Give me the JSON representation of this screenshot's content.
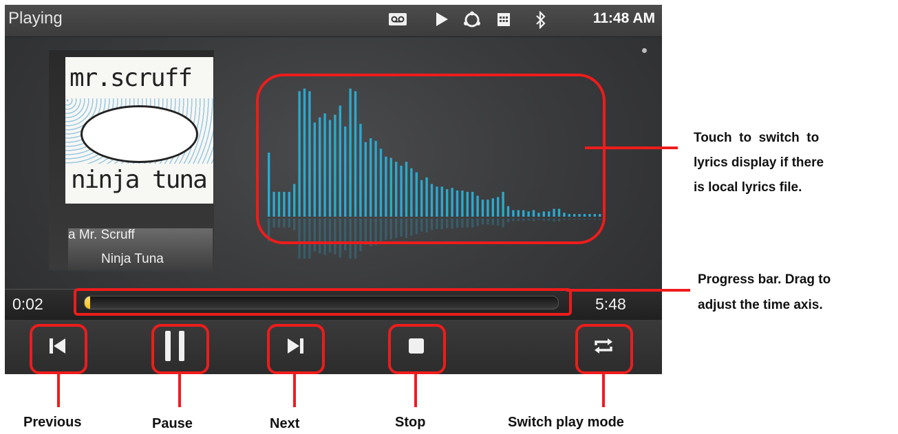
{
  "status_bar": {
    "title": "Playing",
    "time": "11:48 AM",
    "icons": [
      "voicemail-icon",
      "play-status-icon",
      "sync-icon",
      "calendar-icon",
      "bluetooth-icon"
    ]
  },
  "now_playing": {
    "artist": "a Mr. Scruff",
    "album": "Ninja Tuna",
    "cover_text_top": "mr.scruff",
    "cover_text_bottom": "ninja tuna"
  },
  "visualizer": {
    "bar_levels": [
      0.49,
      0.19,
      0.19,
      0.19,
      0.19,
      0.25,
      0.96,
      0.98,
      0.96,
      0.72,
      0.76,
      0.79,
      0.74,
      0.78,
      0.85,
      0.69,
      0.98,
      0.96,
      0.71,
      0.57,
      0.6,
      0.58,
      0.52,
      0.46,
      0.45,
      0.42,
      0.39,
      0.42,
      0.37,
      0.34,
      0.28,
      0.3,
      0.25,
      0.23,
      0.23,
      0.21,
      0.22,
      0.2,
      0.2,
      0.19,
      0.19,
      0.16,
      0.13,
      0.13,
      0.14,
      0.15,
      0.19,
      0.08,
      0.05,
      0.05,
      0.05,
      0.04,
      0.05,
      0.03,
      0.04,
      0.04,
      0.06,
      0.06,
      0.03,
      0.02,
      0.02,
      0.02,
      0.02,
      0.02,
      0.02,
      0.02
    ],
    "color": "#2ba9cf"
  },
  "progress": {
    "elapsed": "0:02",
    "total": "5:48",
    "fraction": 0.006,
    "accent": "#f5c11a"
  },
  "controls": {
    "previous_icon": "previous-icon",
    "pause_icon": "pause-icon",
    "next_icon": "next-icon",
    "stop_icon": "stop-icon",
    "repeat_icon": "repeat-icon"
  },
  "annotations": {
    "lyrics_note": [
      "Touch  to  switch  to",
      "lyrics display if there",
      "is local lyrics file."
    ],
    "progress_note": [
      "Progress bar. Drag to",
      "adjust the time axis."
    ],
    "previous": "Previous",
    "pause": "Pause",
    "next": "Next",
    "stop": "Stop",
    "switch_mode": "Switch play mode",
    "highlight_color": "#ee1c1c"
  }
}
